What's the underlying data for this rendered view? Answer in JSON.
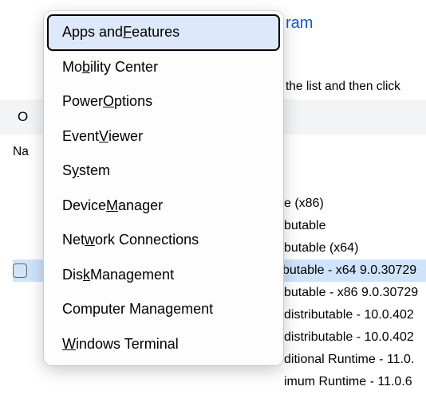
{
  "background": {
    "link_text": "ram",
    "help_suffix": "the list and then click",
    "band_letter": "O",
    "column_header_prefix": "Na",
    "rows": [
      "e (x86)",
      "butable",
      "butable (x64)",
      "butable - x64 9.0.30729",
      "butable - x86 9.0.30729",
      "distributable - 10.0.402",
      "distributable - 10.0.402",
      "ditional Runtime - 11.0.",
      "imum Runtime - 11.0.6"
    ]
  },
  "menu": {
    "items": [
      {
        "pre": "Apps and ",
        "key": "F",
        "post": "eatures"
      },
      {
        "pre": "Mo",
        "key": "b",
        "post": "ility Center"
      },
      {
        "pre": "Power ",
        "key": "O",
        "post": "ptions"
      },
      {
        "pre": "Event ",
        "key": "V",
        "post": "iewer"
      },
      {
        "pre": "S",
        "key": "y",
        "post": "stem"
      },
      {
        "pre": "Device ",
        "key": "M",
        "post": "anager"
      },
      {
        "pre": "Net",
        "key": "w",
        "post": "ork Connections"
      },
      {
        "pre": "Dis",
        "key": "k",
        "post": " Management"
      },
      {
        "pre": "Computer Mana",
        "key": "g",
        "post": "ement"
      },
      {
        "pre": "",
        "key": "W",
        "post": "indows Terminal"
      }
    ],
    "focused_index": 0
  }
}
